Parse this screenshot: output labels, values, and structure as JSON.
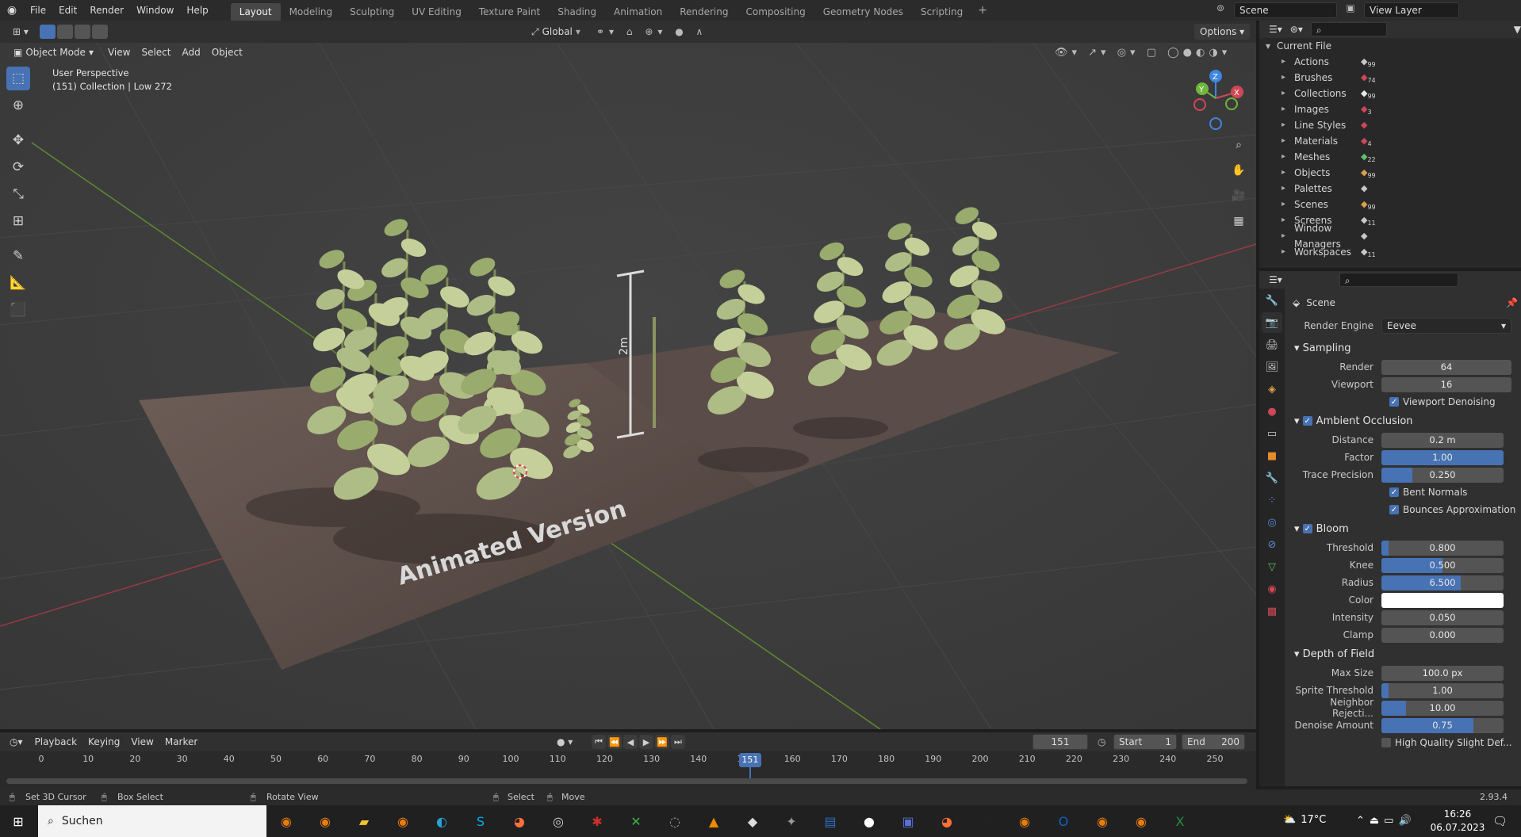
{
  "topbar": {
    "menu": [
      "File",
      "Edit",
      "Render",
      "Window",
      "Help"
    ],
    "workspaces": [
      "Layout",
      "Modeling",
      "Sculpting",
      "UV Editing",
      "Texture Paint",
      "Shading",
      "Animation",
      "Rendering",
      "Compositing",
      "Geometry Nodes",
      "Scripting"
    ],
    "active_workspace": "Layout",
    "add_tab": "+",
    "scene": "Scene",
    "view_layer": "View Layer"
  },
  "viewport_header": {
    "mode": "Object Mode",
    "menus": [
      "View",
      "Select",
      "Add",
      "Object"
    ],
    "orientation": "Global",
    "options": "Options"
  },
  "viewport": {
    "perspective": "User Perspective",
    "collection_info": "(151) Collection | Low 272",
    "scene_texts": {
      "animated": "Animated Version",
      "measure": "2m"
    },
    "axis_colors": {
      "x": "#d04757",
      "y": "#70b53c",
      "z": "#3f86e0"
    },
    "gizmo_labels": {
      "x": "X",
      "y": "Y",
      "z": "Z"
    }
  },
  "outliner": {
    "root": "Current File",
    "items": [
      {
        "label": "Actions",
        "badge": "99"
      },
      {
        "label": "Brushes",
        "badge": "74"
      },
      {
        "label": "Collections",
        "badge": "99"
      },
      {
        "label": "Images",
        "badge": "3"
      },
      {
        "label": "Line Styles",
        "badge": ""
      },
      {
        "label": "Materials",
        "badge": "4"
      },
      {
        "label": "Meshes",
        "badge": "22"
      },
      {
        "label": "Objects",
        "badge": "99"
      },
      {
        "label": "Palettes",
        "badge": ""
      },
      {
        "label": "Scenes",
        "badge": "99"
      },
      {
        "label": "Screens",
        "badge": "11"
      },
      {
        "label": "Window Managers",
        "badge": ""
      },
      {
        "label": "Workspaces",
        "badge": "11"
      }
    ]
  },
  "properties": {
    "context": "Scene",
    "render_engine_label": "Render Engine",
    "render_engine": "Eevee",
    "sampling": {
      "title": "Sampling",
      "render_label": "Render",
      "render": "64",
      "viewport_label": "Viewport",
      "viewport": "16",
      "denoise_label": "Viewport Denoising"
    },
    "ao": {
      "title": "Ambient Occlusion",
      "rows": [
        {
          "label": "Distance",
          "value": "0.2 m",
          "fill": 0
        },
        {
          "label": "Factor",
          "value": "1.00",
          "fill": 1.0
        },
        {
          "label": "Trace Precision",
          "value": "0.250",
          "fill": 0.25
        }
      ],
      "bent_normals": "Bent Normals",
      "bounces": "Bounces Approximation"
    },
    "bloom": {
      "title": "Bloom",
      "rows": [
        {
          "label": "Threshold",
          "value": "0.800",
          "fill": 0.06
        },
        {
          "label": "Knee",
          "value": "0.500",
          "fill": 0.5
        },
        {
          "label": "Radius",
          "value": "6.500",
          "fill": 0.65
        }
      ],
      "color_label": "Color",
      "color": "#ffffff",
      "rows2": [
        {
          "label": "Intensity",
          "value": "0.050",
          "fill": 0
        },
        {
          "label": "Clamp",
          "value": "0.000",
          "fill": 0
        }
      ]
    },
    "dof": {
      "title": "Depth of Field",
      "rows": [
        {
          "label": "Max Size",
          "value": "100.0 px",
          "fill": 0
        },
        {
          "label": "Sprite Threshold",
          "value": "1.00",
          "fill": 0.06
        },
        {
          "label": "Neighbor Rejecti...",
          "value": "10.00",
          "fill": 0.2
        },
        {
          "label": "Denoise Amount",
          "value": "0.75",
          "fill": 0.75
        }
      ],
      "hq": "High Quality Slight Def..."
    }
  },
  "timeline": {
    "menus": [
      "Playback",
      "Keying",
      "View",
      "Marker"
    ],
    "current_frame": "151",
    "start_label": "Start",
    "start": "1",
    "end_label": "End",
    "end": "200",
    "ticks": [
      "0",
      "10",
      "20",
      "30",
      "40",
      "50",
      "60",
      "70",
      "80",
      "90",
      "100",
      "110",
      "120",
      "130",
      "140",
      "150",
      "160",
      "170",
      "180",
      "190",
      "200",
      "210",
      "220",
      "230",
      "240",
      "250"
    ],
    "playhead": "151"
  },
  "statusbar": {
    "items": [
      "Set 3D Cursor",
      "Box Select",
      "Rotate View",
      "Select",
      "Move"
    ],
    "version": "2.93.4"
  },
  "taskbar": {
    "search": "Suchen",
    "weather": "17°C",
    "time": "16:26",
    "date": "06.07.2023"
  }
}
